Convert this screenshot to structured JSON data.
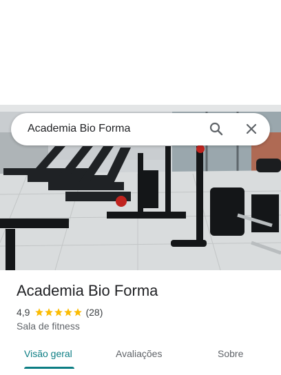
{
  "search": {
    "query": "Academia Bio Forma",
    "search_icon": "search-icon",
    "close_icon": "close-icon"
  },
  "place": {
    "name": "Academia Bio Forma",
    "rating": "4,9",
    "rating_stars": 5,
    "reviews_count": "(28)",
    "category": "Sala de fitness"
  },
  "tabs": [
    {
      "label": "Visão geral",
      "active": true
    },
    {
      "label": "Avaliações",
      "active": false
    },
    {
      "label": "Sobre",
      "active": false
    }
  ],
  "colors": {
    "accent": "#0b7d83",
    "star": "#fbbc04",
    "text": "#202124",
    "secondary": "#5f6368"
  }
}
